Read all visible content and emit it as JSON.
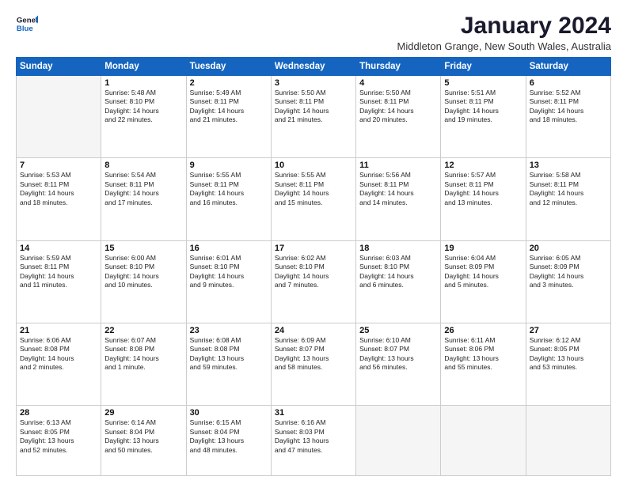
{
  "logo": {
    "line1": "General",
    "line2": "Blue"
  },
  "title": "January 2024",
  "location": "Middleton Grange, New South Wales, Australia",
  "days_of_week": [
    "Sunday",
    "Monday",
    "Tuesday",
    "Wednesday",
    "Thursday",
    "Friday",
    "Saturday"
  ],
  "weeks": [
    [
      {
        "day": "",
        "lines": []
      },
      {
        "day": "1",
        "lines": [
          "Sunrise: 5:48 AM",
          "Sunset: 8:10 PM",
          "Daylight: 14 hours",
          "and 22 minutes."
        ]
      },
      {
        "day": "2",
        "lines": [
          "Sunrise: 5:49 AM",
          "Sunset: 8:11 PM",
          "Daylight: 14 hours",
          "and 21 minutes."
        ]
      },
      {
        "day": "3",
        "lines": [
          "Sunrise: 5:50 AM",
          "Sunset: 8:11 PM",
          "Daylight: 14 hours",
          "and 21 minutes."
        ]
      },
      {
        "day": "4",
        "lines": [
          "Sunrise: 5:50 AM",
          "Sunset: 8:11 PM",
          "Daylight: 14 hours",
          "and 20 minutes."
        ]
      },
      {
        "day": "5",
        "lines": [
          "Sunrise: 5:51 AM",
          "Sunset: 8:11 PM",
          "Daylight: 14 hours",
          "and 19 minutes."
        ]
      },
      {
        "day": "6",
        "lines": [
          "Sunrise: 5:52 AM",
          "Sunset: 8:11 PM",
          "Daylight: 14 hours",
          "and 18 minutes."
        ]
      }
    ],
    [
      {
        "day": "7",
        "lines": [
          "Sunrise: 5:53 AM",
          "Sunset: 8:11 PM",
          "Daylight: 14 hours",
          "and 18 minutes."
        ]
      },
      {
        "day": "8",
        "lines": [
          "Sunrise: 5:54 AM",
          "Sunset: 8:11 PM",
          "Daylight: 14 hours",
          "and 17 minutes."
        ]
      },
      {
        "day": "9",
        "lines": [
          "Sunrise: 5:55 AM",
          "Sunset: 8:11 PM",
          "Daylight: 14 hours",
          "and 16 minutes."
        ]
      },
      {
        "day": "10",
        "lines": [
          "Sunrise: 5:55 AM",
          "Sunset: 8:11 PM",
          "Daylight: 14 hours",
          "and 15 minutes."
        ]
      },
      {
        "day": "11",
        "lines": [
          "Sunrise: 5:56 AM",
          "Sunset: 8:11 PM",
          "Daylight: 14 hours",
          "and 14 minutes."
        ]
      },
      {
        "day": "12",
        "lines": [
          "Sunrise: 5:57 AM",
          "Sunset: 8:11 PM",
          "Daylight: 14 hours",
          "and 13 minutes."
        ]
      },
      {
        "day": "13",
        "lines": [
          "Sunrise: 5:58 AM",
          "Sunset: 8:11 PM",
          "Daylight: 14 hours",
          "and 12 minutes."
        ]
      }
    ],
    [
      {
        "day": "14",
        "lines": [
          "Sunrise: 5:59 AM",
          "Sunset: 8:11 PM",
          "Daylight: 14 hours",
          "and 11 minutes."
        ]
      },
      {
        "day": "15",
        "lines": [
          "Sunrise: 6:00 AM",
          "Sunset: 8:10 PM",
          "Daylight: 14 hours",
          "and 10 minutes."
        ]
      },
      {
        "day": "16",
        "lines": [
          "Sunrise: 6:01 AM",
          "Sunset: 8:10 PM",
          "Daylight: 14 hours",
          "and 9 minutes."
        ]
      },
      {
        "day": "17",
        "lines": [
          "Sunrise: 6:02 AM",
          "Sunset: 8:10 PM",
          "Daylight: 14 hours",
          "and 7 minutes."
        ]
      },
      {
        "day": "18",
        "lines": [
          "Sunrise: 6:03 AM",
          "Sunset: 8:10 PM",
          "Daylight: 14 hours",
          "and 6 minutes."
        ]
      },
      {
        "day": "19",
        "lines": [
          "Sunrise: 6:04 AM",
          "Sunset: 8:09 PM",
          "Daylight: 14 hours",
          "and 5 minutes."
        ]
      },
      {
        "day": "20",
        "lines": [
          "Sunrise: 6:05 AM",
          "Sunset: 8:09 PM",
          "Daylight: 14 hours",
          "and 3 minutes."
        ]
      }
    ],
    [
      {
        "day": "21",
        "lines": [
          "Sunrise: 6:06 AM",
          "Sunset: 8:08 PM",
          "Daylight: 14 hours",
          "and 2 minutes."
        ]
      },
      {
        "day": "22",
        "lines": [
          "Sunrise: 6:07 AM",
          "Sunset: 8:08 PM",
          "Daylight: 14 hours",
          "and 1 minute."
        ]
      },
      {
        "day": "23",
        "lines": [
          "Sunrise: 6:08 AM",
          "Sunset: 8:08 PM",
          "Daylight: 13 hours",
          "and 59 minutes."
        ]
      },
      {
        "day": "24",
        "lines": [
          "Sunrise: 6:09 AM",
          "Sunset: 8:07 PM",
          "Daylight: 13 hours",
          "and 58 minutes."
        ]
      },
      {
        "day": "25",
        "lines": [
          "Sunrise: 6:10 AM",
          "Sunset: 8:07 PM",
          "Daylight: 13 hours",
          "and 56 minutes."
        ]
      },
      {
        "day": "26",
        "lines": [
          "Sunrise: 6:11 AM",
          "Sunset: 8:06 PM",
          "Daylight: 13 hours",
          "and 55 minutes."
        ]
      },
      {
        "day": "27",
        "lines": [
          "Sunrise: 6:12 AM",
          "Sunset: 8:05 PM",
          "Daylight: 13 hours",
          "and 53 minutes."
        ]
      }
    ],
    [
      {
        "day": "28",
        "lines": [
          "Sunrise: 6:13 AM",
          "Sunset: 8:05 PM",
          "Daylight: 13 hours",
          "and 52 minutes."
        ]
      },
      {
        "day": "29",
        "lines": [
          "Sunrise: 6:14 AM",
          "Sunset: 8:04 PM",
          "Daylight: 13 hours",
          "and 50 minutes."
        ]
      },
      {
        "day": "30",
        "lines": [
          "Sunrise: 6:15 AM",
          "Sunset: 8:04 PM",
          "Daylight: 13 hours",
          "and 48 minutes."
        ]
      },
      {
        "day": "31",
        "lines": [
          "Sunrise: 6:16 AM",
          "Sunset: 8:03 PM",
          "Daylight: 13 hours",
          "and 47 minutes."
        ]
      },
      {
        "day": "",
        "lines": []
      },
      {
        "day": "",
        "lines": []
      },
      {
        "day": "",
        "lines": []
      }
    ]
  ]
}
